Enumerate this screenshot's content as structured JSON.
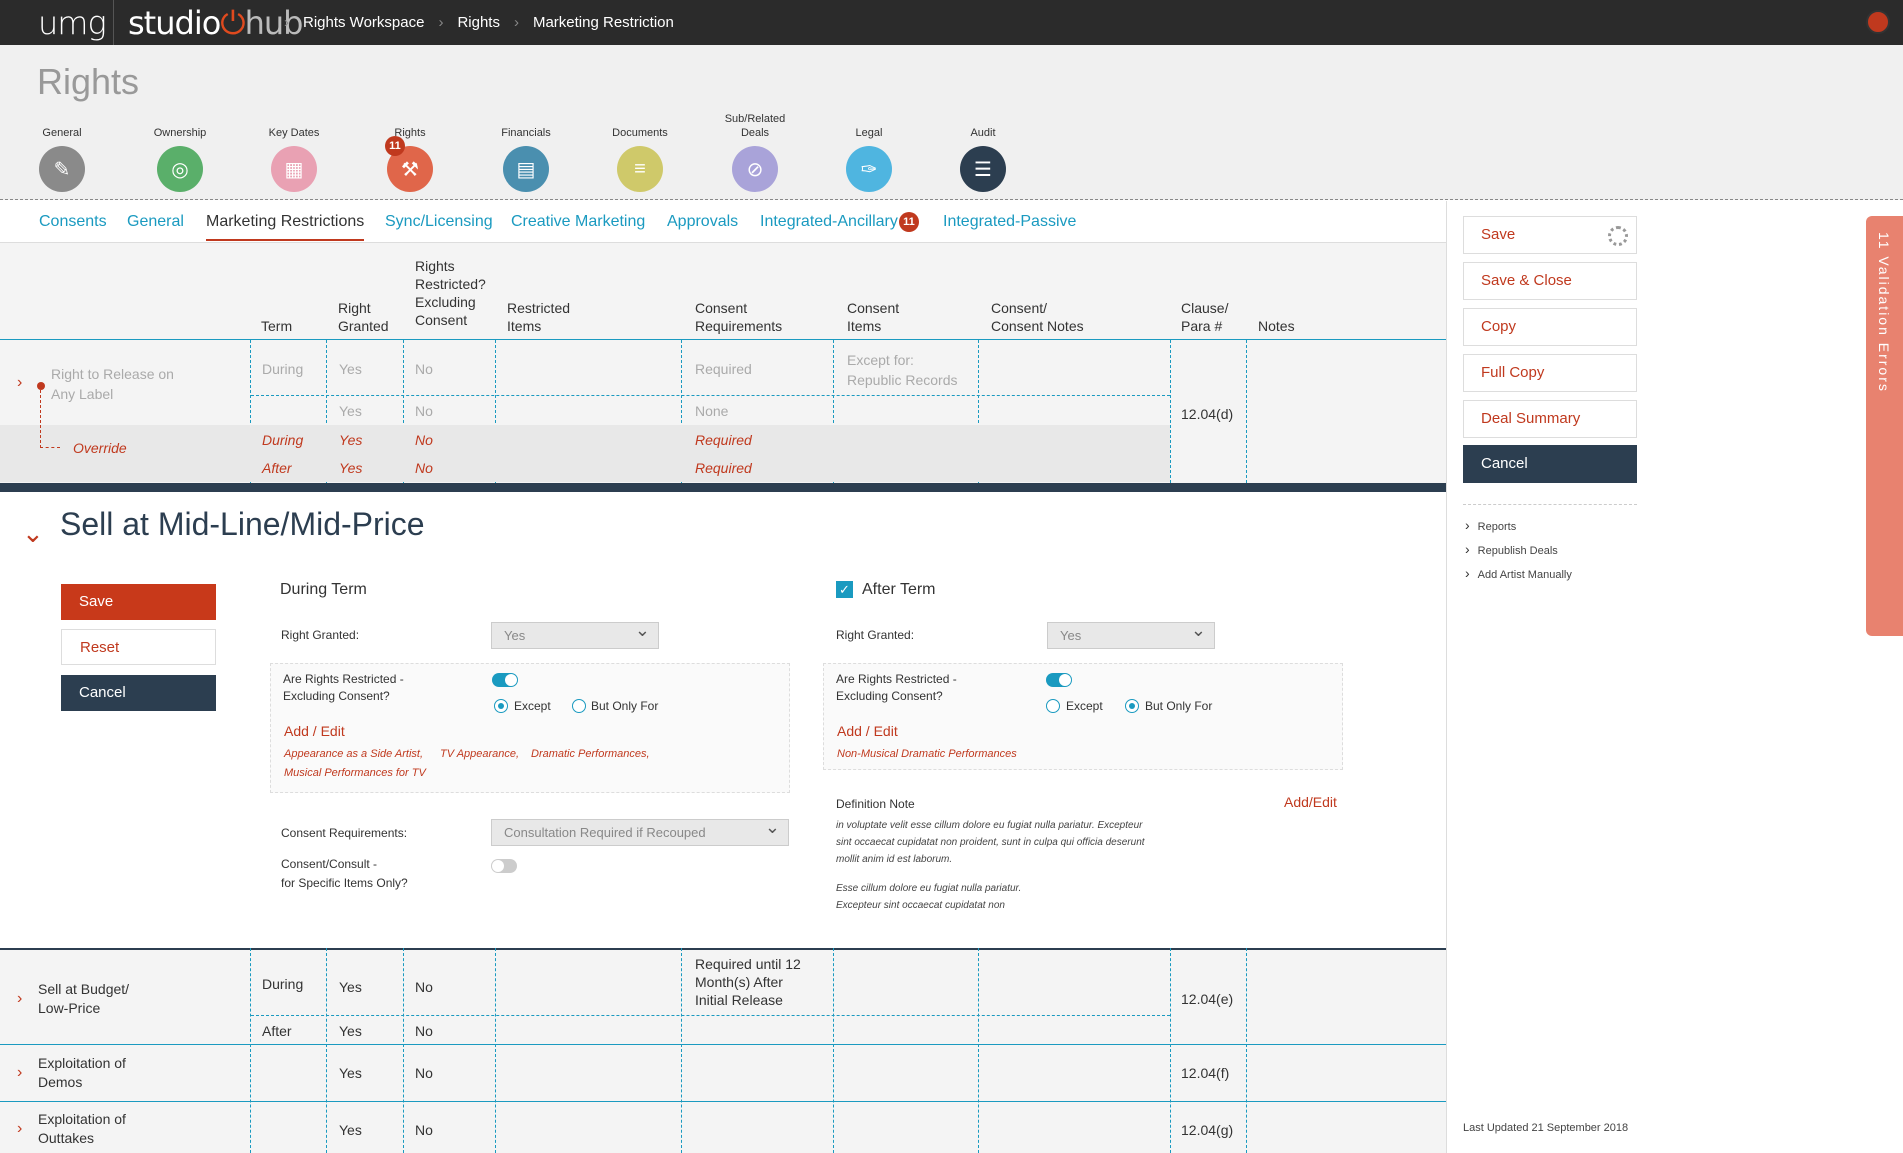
{
  "topbar": {
    "logo_umg": "umg",
    "logo_studio": "studio",
    "logo_hub": "hub",
    "breadcrumb": [
      "Rights Workspace",
      "Rights",
      "Marketing Restriction"
    ]
  },
  "header": {
    "title": "Rights",
    "nav": [
      {
        "label": "General",
        "icon": "paperclip-icon",
        "color": "#8a8a8a"
      },
      {
        "label": "Ownership",
        "icon": "target-icon",
        "color": "#5aaf6a"
      },
      {
        "label": "Key Dates",
        "icon": "calendar-icon",
        "color": "#e9a1b3"
      },
      {
        "label": "Rights",
        "icon": "gavel-icon",
        "color": "#e0664a",
        "badge": "11",
        "note": "Errors"
      },
      {
        "label": "Financials",
        "icon": "calculator-icon",
        "color": "#4a8faf"
      },
      {
        "label": "Documents",
        "icon": "list-icon",
        "color": "#cfc96a"
      },
      {
        "label": "Sub/Related Deals",
        "icon": "link-icon",
        "color": "#a9a3d9"
      },
      {
        "label": "Legal",
        "icon": "feather-icon",
        "color": "#4fb5e0"
      },
      {
        "label": "Audit",
        "icon": "checklist-icon",
        "color": "#2c3e50"
      }
    ]
  },
  "tabs": [
    {
      "label": "Consents"
    },
    {
      "label": "General"
    },
    {
      "label": "Marketing Restrictions",
      "active": true
    },
    {
      "label": "Sync/Licensing"
    },
    {
      "label": "Creative Marketing"
    },
    {
      "label": "Approvals"
    },
    {
      "label": "Integrated-Ancillary",
      "badge": "11"
    },
    {
      "label": "Integrated-Passive"
    }
  ],
  "grid": {
    "columns": [
      "Term",
      "Right Granted",
      "Rights Restricted? Excluding Consent",
      "Restricted Items",
      "Consent Requirements",
      "Consent Items",
      "Consent/ Consent Notes",
      "Clause/ Para #",
      "Notes"
    ],
    "row1": {
      "name": "Right to Release on Any Label",
      "during": {
        "term": "During",
        "granted": "Yes",
        "restricted": "No",
        "consent_req": "Required",
        "consent_items": "Except for: Republic Records"
      },
      "after": {
        "granted": "Yes",
        "restricted": "No",
        "consent_req": "None"
      },
      "clause": "12.04(d)",
      "override": {
        "label": "Override",
        "during": {
          "term": "During",
          "granted": "Yes",
          "restricted": "No",
          "consent_req": "Required"
        },
        "after": {
          "term": "After",
          "granted": "Yes",
          "restricted": "No",
          "consent_req": "Required"
        }
      }
    }
  },
  "detail": {
    "title": "Sell at Mid-Line/Mid-Price",
    "buttons": {
      "save": "Save",
      "reset": "Reset",
      "cancel": "Cancel"
    },
    "during": {
      "heading": "During Term",
      "right_granted_label": "Right Granted:",
      "right_granted_value": "Yes",
      "restricted_label_1": "Are Rights Restricted -",
      "restricted_label_2": "Excluding Consent?",
      "restricted_toggle": true,
      "radio_except": "Except",
      "radio_but_only": "But Only For",
      "selected_radio": "Except",
      "add_edit": "Add / Edit",
      "items_line1": [
        "Appearance as a Side Artist,",
        "TV Appearance,",
        "Dramatic Performances,"
      ],
      "items_line2": "Musical Performances for TV",
      "consent_req_label": "Consent Requirements:",
      "consent_req_value": "Consultation Required if Recouped",
      "consent_specific_label_1": "Consent/Consult -",
      "consent_specific_label_2": "for Specific Items Only?",
      "consent_specific_toggle": false
    },
    "after": {
      "heading": "After Term",
      "checked": true,
      "right_granted_label": "Right Granted:",
      "right_granted_value": "Yes",
      "restricted_label_1": "Are Rights Restricted -",
      "restricted_label_2": "Excluding Consent?",
      "restricted_toggle": true,
      "radio_except": "Except",
      "radio_but_only": "But Only For",
      "selected_radio": "But Only For",
      "add_edit": "Add / Edit",
      "items": "Non-Musical Dramatic Performances",
      "definition_label": "Definition Note",
      "definition_add_edit": "Add/Edit",
      "note_p1": [
        "in voluptate velit esse cillum dolore eu fugiat nulla pariatur. Excepteur",
        "sint occaecat cupidatat non proident, sunt in culpa qui officia deserunt",
        "mollit anim id est laborum."
      ],
      "note_p2": [
        "Esse cillum dolore eu fugiat nulla pariatur.",
        "Excepteur sint occaecat cupidatat non"
      ]
    }
  },
  "bottom_rows": [
    {
      "name_1": "Sell at Budget/",
      "name_2": "Low-Price",
      "during": {
        "term": "During",
        "granted": "Yes",
        "restricted": "No",
        "consent_req": [
          "Required until 12",
          "Month(s) After",
          "Initial Release"
        ]
      },
      "after": {
        "term": "After",
        "granted": "Yes",
        "restricted": "No"
      },
      "clause": "12.04(e)"
    },
    {
      "name_1": "Exploitation of",
      "name_2": "Demos",
      "granted": "Yes",
      "restricted": "No",
      "clause": "12.04(f)"
    },
    {
      "name_1": "Exploitation of",
      "name_2": "Outtakes",
      "granted": "Yes",
      "restricted": "No",
      "clause": "12.04(g)"
    }
  ],
  "sidebar": {
    "buttons": [
      "Save",
      "Save & Close",
      "Copy",
      "Full Copy",
      "Deal Summary",
      "Cancel"
    ],
    "links": [
      "Reports",
      "Republish Deals",
      "Add Artist Manually"
    ],
    "last_updated": "Last Updated 21 September 2018",
    "validation_tab": "11 Validation Errors"
  }
}
